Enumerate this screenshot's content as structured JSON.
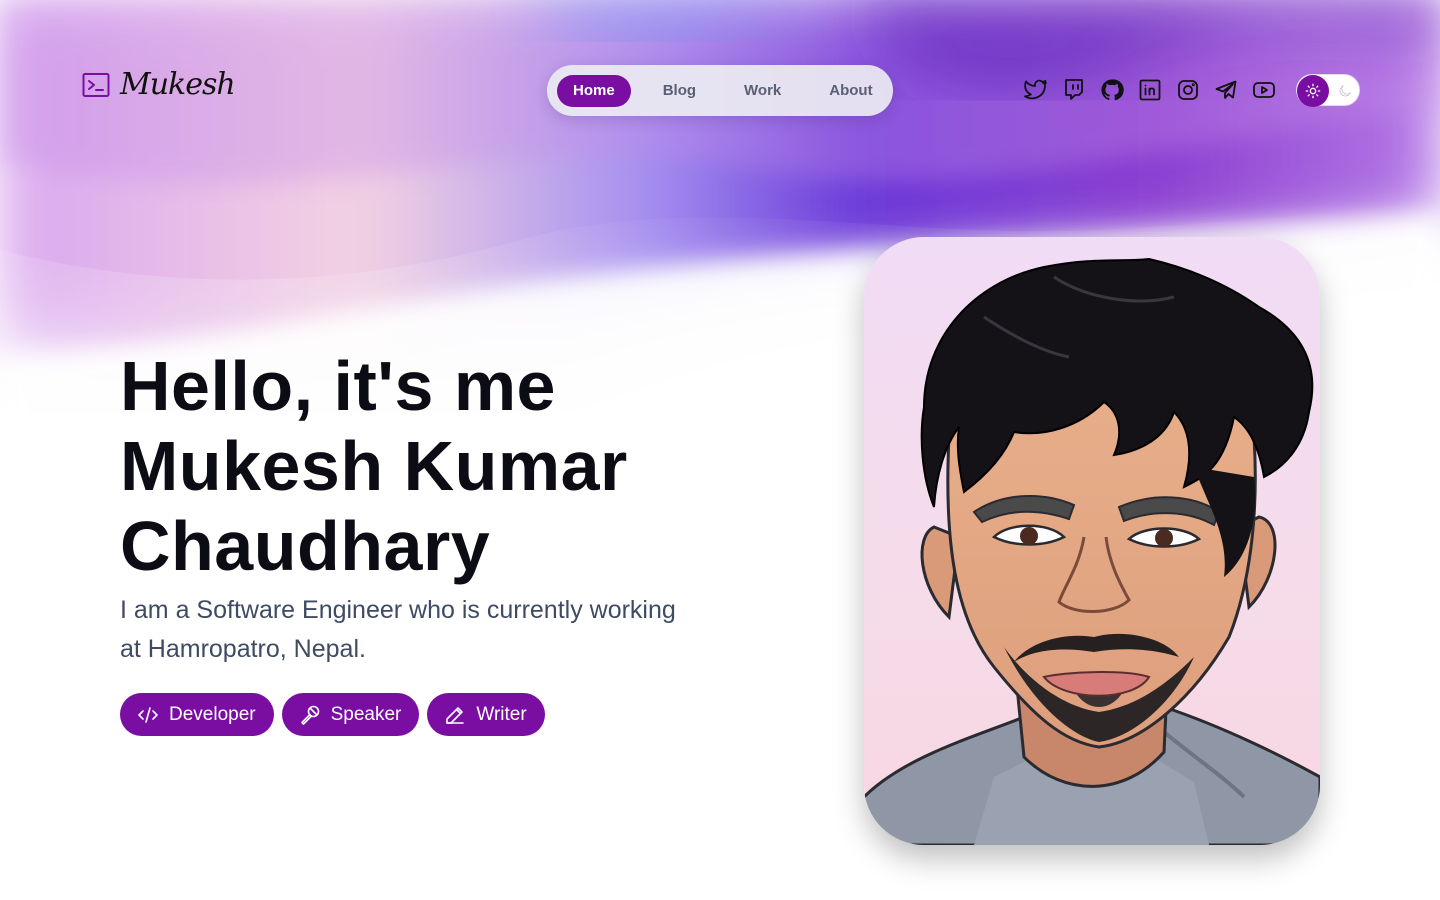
{
  "brand": {
    "logo_icon": "terminal-icon",
    "signature": "Mukesh",
    "accent_color": "#7a0ea3"
  },
  "nav": {
    "items": [
      {
        "label": "Home",
        "active": true
      },
      {
        "label": "Blog",
        "active": false
      },
      {
        "label": "Work",
        "active": false
      },
      {
        "label": "About",
        "active": false
      }
    ]
  },
  "socials": [
    {
      "icon": "twitter-icon"
    },
    {
      "icon": "twitch-icon"
    },
    {
      "icon": "github-icon"
    },
    {
      "icon": "linkedin-icon"
    },
    {
      "icon": "instagram-icon"
    },
    {
      "icon": "telegram-icon"
    },
    {
      "icon": "youtube-icon"
    }
  ],
  "theme_toggle": {
    "active_icon": "sun-icon",
    "inactive_icon": "moon-icon",
    "mode": "light"
  },
  "hero": {
    "title_lines": [
      "Hello, it's me",
      "Mukesh Kumar",
      "Chaudhary"
    ],
    "subtitle": "I am a Software Engineer who is currently working at Hamropatro, Nepal.",
    "tags": [
      {
        "label": "Developer",
        "icon": "code-icon"
      },
      {
        "label": "Speaker",
        "icon": "microphone-icon"
      },
      {
        "label": "Writer",
        "icon": "pencil-icon"
      }
    ]
  },
  "portrait": {
    "subject": "illustrated-portrait"
  }
}
